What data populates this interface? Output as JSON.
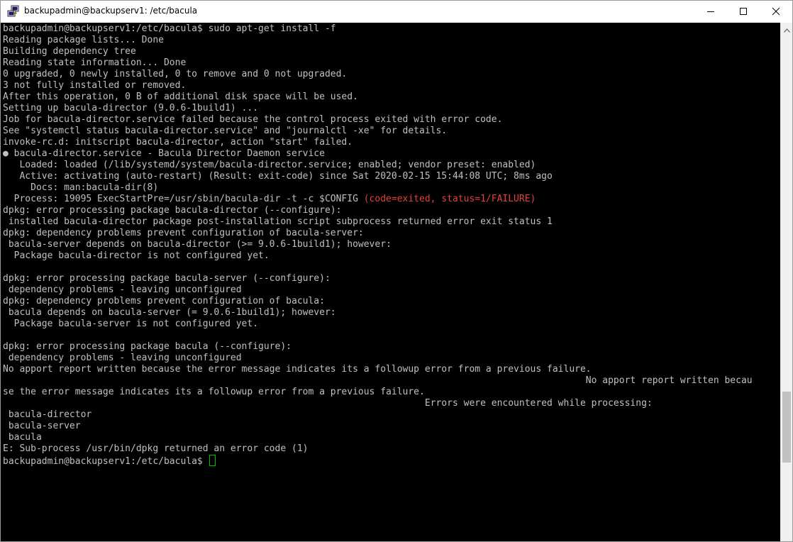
{
  "window": {
    "title": "backupadmin@backupserv1: /etc/bacula",
    "icon": "putty-icon",
    "controls": {
      "minimize": "minimize-icon",
      "maximize": "maximize-icon",
      "close": "close-icon"
    }
  },
  "colors": {
    "terminal_background": "#000000",
    "terminal_text": "#c0c0c0",
    "error_text": "#e0433a",
    "cursor": "#00c000"
  },
  "terminal": {
    "lines": [
      "backupadmin@backupserv1:/etc/bacula$ sudo apt-get install -f",
      "Reading package lists... Done",
      "Building dependency tree",
      "Reading state information... Done",
      "0 upgraded, 0 newly installed, 0 to remove and 0 not upgraded.",
      "3 not fully installed or removed.",
      "After this operation, 0 B of additional disk space will be used.",
      "Setting up bacula-director (9.0.6-1build1) ...",
      "Job for bacula-director.service failed because the control process exited with error code.",
      "See \"systemctl status bacula-director.service\" and \"journalctl -xe\" for details.",
      "invoke-rc.d: initscript bacula-director, action \"start\" failed.",
      "● bacula-director.service - Bacula Director Daemon service",
      "   Loaded: loaded (/lib/systemd/system/bacula-director.service; enabled; vendor preset: enabled)",
      "   Active: activating (auto-restart) (Result: exit-code) since Sat 2020-02-15 15:44:08 UTC; 8ms ago",
      "     Docs: man:bacula-dir(8)",
      "  Process: 19095 ExecStartPre=/usr/sbin/bacula-dir -t -c $CONFIG ",
      "dpkg: error processing package bacula-director (--configure):",
      " installed bacula-director package post-installation script subprocess returned error exit status 1",
      "dpkg: dependency problems prevent configuration of bacula-server:",
      " bacula-server depends on bacula-director (>= 9.0.6-1build1); however:",
      "  Package bacula-director is not configured yet.",
      "",
      "dpkg: error processing package bacula-server (--configure):",
      " dependency problems - leaving unconfigured",
      "dpkg: dependency problems prevent configuration of bacula:",
      " bacula depends on bacula-server (= 9.0.6-1build1); however:",
      "  Package bacula-server is not configured yet.",
      "",
      "dpkg: error processing package bacula (--configure):",
      " dependency problems - leaving unconfigured",
      "No apport report written because the error message indicates its a followup error from a previous failure.",
      "                                                                                                         No apport report written becau",
      "se the error message indicates its a followup error from a previous failure.",
      "                                                                            Errors were encountered while processing:",
      " bacula-director",
      " bacula-server",
      " bacula",
      "E: Sub-process /usr/bin/dpkg returned an error code (1)",
      "backupadmin@backupserv1:/etc/bacula$ "
    ],
    "error_segment": {
      "line_index": 15,
      "text": "(code=exited, status=1/FAILURE)"
    },
    "cursor_line_index": 38
  },
  "scrollbar": {
    "up_arrow": "scroll-up-arrow-icon",
    "position_fraction": 0.82,
    "visible_fraction": 0.14
  }
}
